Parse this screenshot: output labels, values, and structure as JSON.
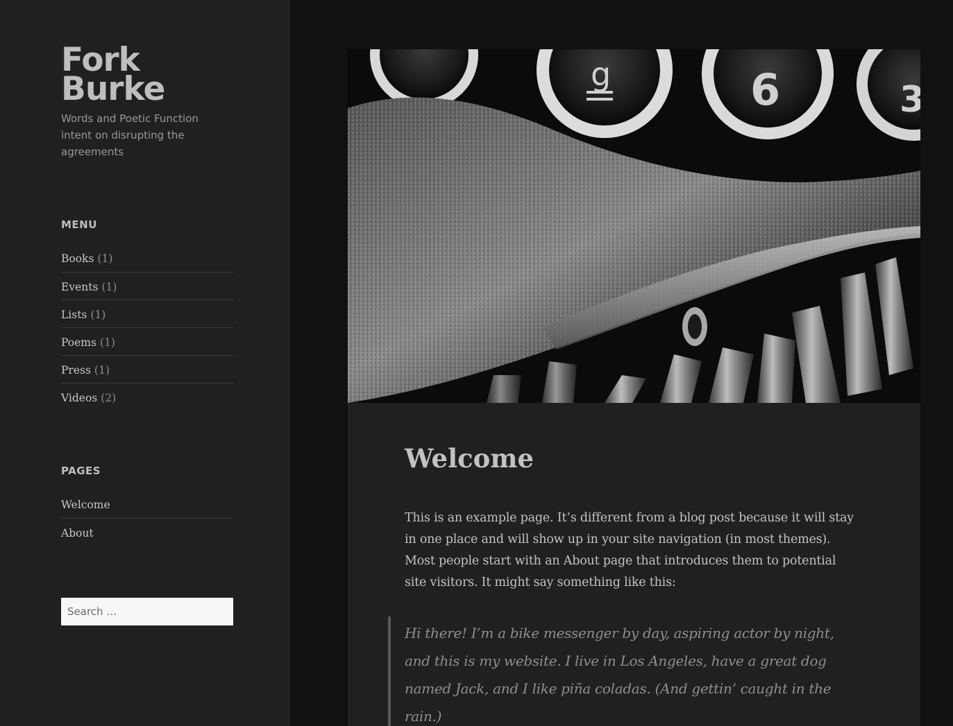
{
  "site": {
    "title": "Fork Burke",
    "description": "Words and Poetic Function intent on disrupting the agreements"
  },
  "sidebar": {
    "menu": {
      "heading": "MENU",
      "items": [
        {
          "label": "Books",
          "count": "(1)"
        },
        {
          "label": "Events",
          "count": "(1)"
        },
        {
          "label": "Lists",
          "count": "(1)"
        },
        {
          "label": "Poems",
          "count": "(1)"
        },
        {
          "label": "Press",
          "count": "(1)"
        },
        {
          "label": "Videos",
          "count": "(2)"
        }
      ]
    },
    "pages": {
      "heading": "PAGES",
      "items": [
        {
          "label": "Welcome"
        },
        {
          "label": "About"
        }
      ]
    },
    "search": {
      "placeholder": "Search …"
    }
  },
  "article": {
    "title": "Welcome",
    "body": "This is an example page. It’s different from a blog post because it will stay in one place and will show up in your site navigation (in most themes). Most people start with an About page that introduces them to potential site visitors. It might say something like this:",
    "quote": "Hi there! I’m a bike messenger by day, aspiring actor by night, and this is my website. I live in Los Angeles, have a great dog named Jack, and I like piña coladas. (And gettin’ caught in the rain.)"
  },
  "colors": {
    "page_background": "#111111",
    "panel_background": "#202020",
    "text_primary": "#c4c4c4",
    "text_muted": "#8f8f8f",
    "search_background": "#f7f7f7"
  }
}
